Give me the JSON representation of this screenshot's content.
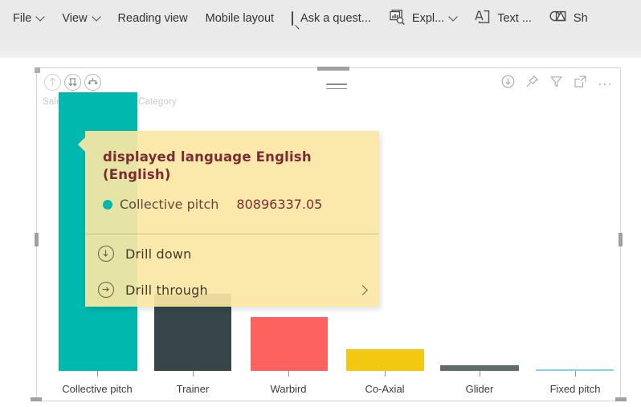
{
  "menubar": {
    "items": [
      {
        "label": "File",
        "icon": null,
        "caret": true
      },
      {
        "label": "View",
        "icon": null,
        "caret": true
      },
      {
        "label": "Reading view",
        "icon": null,
        "caret": false
      },
      {
        "label": "Mobile layout",
        "icon": null,
        "caret": false
      },
      {
        "label": "Ask a quest...",
        "icon": "speech-bubble-icon",
        "caret": false
      },
      {
        "label": "Expl...",
        "icon": "explore-magnifier-icon",
        "caret": true
      },
      {
        "label": "Text ...",
        "icon": "text-box-icon",
        "caret": false
      },
      {
        "label": "Sh",
        "icon": "shapes-icon",
        "caret": false
      }
    ]
  },
  "back_button": {
    "name": "back-arrow-icon"
  },
  "visual": {
    "title": "Sales and Quantity by Category",
    "drill_controls": [
      {
        "name": "drill-up-icon",
        "enabled": false
      },
      {
        "name": "drill-down-toggle-icon",
        "enabled": true
      },
      {
        "name": "expand-next-level-icon",
        "enabled": true
      }
    ],
    "menu_icon": "visual-menu-hamburger-icon",
    "actions": [
      {
        "name": "drill-mode-icon"
      },
      {
        "name": "pin-visual-icon"
      },
      {
        "name": "filter-icon"
      },
      {
        "name": "focus-mode-icon"
      },
      {
        "name": "more-options-icon",
        "label": "..."
      }
    ]
  },
  "tooltip": {
    "title": "displayed language English (English)",
    "series_dot_color": "#00b7ad",
    "series_label": "Collective pitch",
    "series_value": "80896337.05",
    "actions": [
      {
        "label": "Drill down",
        "icon": "drill-down-circle-icon",
        "submenu": false
      },
      {
        "label": "Drill through",
        "icon": "drill-through-circle-icon",
        "submenu": true
      }
    ]
  },
  "chart_data": {
    "type": "bar",
    "title": "Sales and Quantity by Category",
    "xlabel": "",
    "ylabel": "",
    "grid": false,
    "legend": "none",
    "categories": [
      "Collective pitch",
      "Trainer",
      "Warbird",
      "Co-Axial",
      "Glider",
      "Fixed pitch"
    ],
    "series": [
      {
        "name": "Collective pitch",
        "values": [
          80896337.05,
          22300000,
          15700000,
          6200000,
          1600000,
          150000
        ]
      }
    ],
    "bar_colors": [
      "#01b8af",
      "#374649",
      "#fd625e",
      "#f2c811",
      "#5f6b6d",
      "#8ad4eb"
    ],
    "highlighted_category": "Collective pitch",
    "highlighted_value": "80896337.05",
    "ylim": [
      0,
      83000000
    ]
  }
}
